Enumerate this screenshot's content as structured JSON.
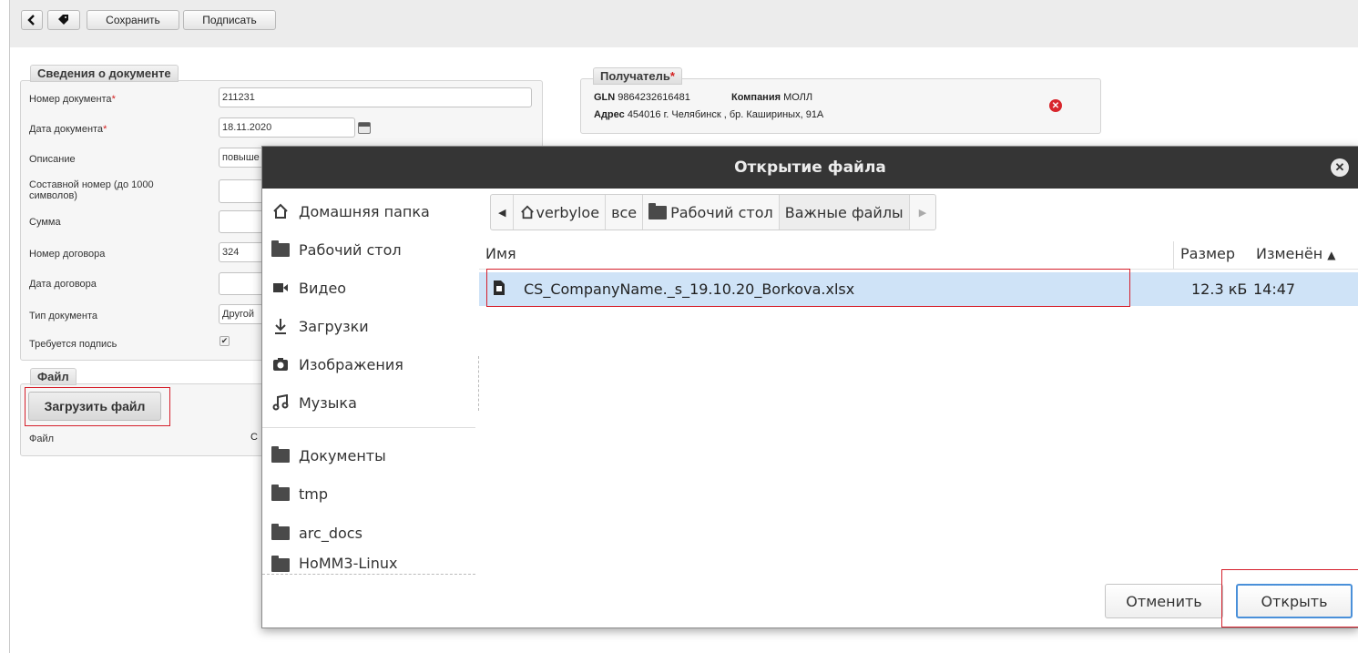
{
  "toolbar": {
    "back_icon": "arrow-left-icon",
    "tag_icon": "tag-icon",
    "save_label": "Сохранить",
    "sign_label": "Подписать"
  },
  "document_info": {
    "legend": "Сведения о документе",
    "fields": {
      "number": {
        "label": "Номер документа",
        "value": "211231"
      },
      "date": {
        "label": "Дата документа",
        "value": "18.11.2020"
      },
      "description": {
        "label": "Описание",
        "value": "повыше"
      },
      "compound": {
        "label": "Составной номер (до 1000 символов)",
        "value": ""
      },
      "sum": {
        "label": "Сумма",
        "value": ""
      },
      "contract_number": {
        "label": "Номер договора",
        "value": "324"
      },
      "contract_date": {
        "label": "Дата договора",
        "value": ""
      },
      "doc_type": {
        "label": "Тип документа",
        "value": "Другой"
      },
      "needs_sign": {
        "label": "Требуется подпись",
        "checked": true
      }
    }
  },
  "recipient": {
    "legend": "Получатель",
    "gln_label": "GLN",
    "gln_value": "9864232616481",
    "company_label": "Компания",
    "company_value": "МОЛЛ",
    "address_label": "Адрес",
    "address_value": "454016 г. Челябинск , бр. Кашириных, 91А"
  },
  "file_section": {
    "legend": "Файл",
    "upload_label": "Загрузить файл",
    "file_label": "Файл",
    "file_value": "C"
  },
  "dialog": {
    "title": "Открытие файла",
    "places": [
      {
        "label": "Домашняя папка",
        "icon": "home-icon"
      },
      {
        "label": "Рабочий стол",
        "icon": "folder-icon"
      },
      {
        "label": "Видео",
        "icon": "video-icon"
      },
      {
        "label": "Загрузки",
        "icon": "download-icon"
      },
      {
        "label": "Изображения",
        "icon": "camera-icon"
      },
      {
        "label": "Музыка",
        "icon": "music-icon"
      },
      {
        "label": "Документы",
        "icon": "folder-icon"
      },
      {
        "label": "tmp",
        "icon": "folder-icon"
      },
      {
        "label": "arc_docs",
        "icon": "folder-icon"
      },
      {
        "label": "HoMM3-Linux",
        "icon": "folder-icon"
      }
    ],
    "breadcrumb": [
      "verbyloe",
      "все",
      "Рабочий стол",
      "Важные файлы"
    ],
    "columns": {
      "name": "Имя",
      "size": "Размер",
      "modified": "Изменён"
    },
    "files": [
      {
        "name": "CS_CompanyName._s_19.10.20_Borkova.xlsx",
        "size": "12.3 кБ",
        "modified": "14:47"
      }
    ],
    "cancel_label": "Отменить",
    "open_label": "Открыть"
  }
}
